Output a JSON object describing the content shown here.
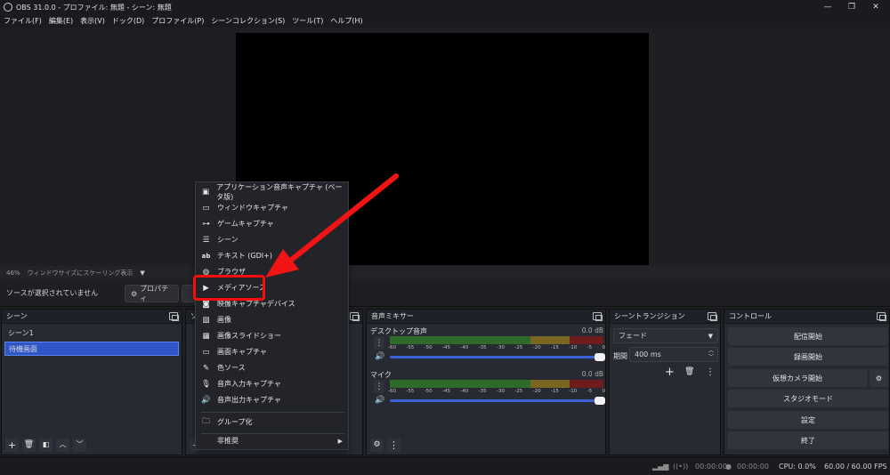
{
  "window": {
    "title": "OBS 31.0.0 - プロファイル: 無題 - シーン: 無題"
  },
  "menu": [
    "ファイル(F)",
    "編集(E)",
    "表示(V)",
    "ドック(D)",
    "プロファイル(P)",
    "シーンコレクション(S)",
    "ツール(T)",
    "ヘルプ(H)"
  ],
  "preview_bar": {
    "zoom": "46%",
    "scaling": "ウィンドウサイズにスケーリング表示"
  },
  "source_toolbar": {
    "no_source": "ソースが選択されていません",
    "properties": "プロパティ"
  },
  "scenes": {
    "title": "シーン",
    "items": [
      "シーン1",
      "待機画面"
    ],
    "selected_index": 1
  },
  "sources": {
    "title_fragment": "ソ"
  },
  "mixer": {
    "title": "音声ミキサー",
    "channels": [
      {
        "name": "デスクトップ音声",
        "db": "0.0 dB"
      },
      {
        "name": "マイク",
        "db": "0.0 dB"
      }
    ],
    "ticks": [
      "-60",
      "-55",
      "-50",
      "-45",
      "-40",
      "-35",
      "-30",
      "-25",
      "-20",
      "-15",
      "-10",
      "-5",
      "0"
    ]
  },
  "transitions": {
    "title": "シーントランジション",
    "type": "フェード",
    "duration_label": "期間",
    "duration": "400 ms"
  },
  "controls": {
    "title": "コントロール",
    "buttons": [
      "配信開始",
      "録画開始",
      "仮想カメラ開始",
      "スタジオモード",
      "設定",
      "終了"
    ]
  },
  "statusbar": {
    "stream_time": "00:00:00",
    "record_time": "00:00:00",
    "cpu": "CPU: 0.0%",
    "fps": "60.00 / 60.00 FPS"
  },
  "context_menu": {
    "items": [
      {
        "label": "アプリケーション音声キャプチャ (ベータ版)",
        "icon": "app-audio-icon"
      },
      {
        "label": "ウィンドウキャプチャ",
        "icon": "window-icon"
      },
      {
        "label": "ゲームキャプチャ",
        "icon": "gamepad-icon"
      },
      {
        "label": "シーン",
        "icon": "list-icon"
      },
      {
        "label": "テキスト (GDI+)",
        "icon": "text-icon"
      },
      {
        "label": "ブラウザ",
        "icon": "globe-icon"
      },
      {
        "label": "メディアソース",
        "icon": "play-icon"
      },
      {
        "label": "映像キャプチャデバイス",
        "icon": "camera-icon"
      },
      {
        "label": "画像",
        "icon": "image-icon"
      },
      {
        "label": "画像スライドショー",
        "icon": "slideshow-icon"
      },
      {
        "label": "画面キャプチャ",
        "icon": "monitor-icon"
      },
      {
        "label": "色ソース",
        "icon": "brush-icon"
      },
      {
        "label": "音声入力キャプチャ",
        "icon": "microphone-icon"
      },
      {
        "label": "音声出力キャプチャ",
        "icon": "speaker-icon"
      }
    ],
    "group": "グループ化",
    "deprecated": "非推奨"
  },
  "colors": {
    "highlight": "#ff0a0a",
    "selection": "#2f55c8",
    "fader": "#3c63d6"
  }
}
